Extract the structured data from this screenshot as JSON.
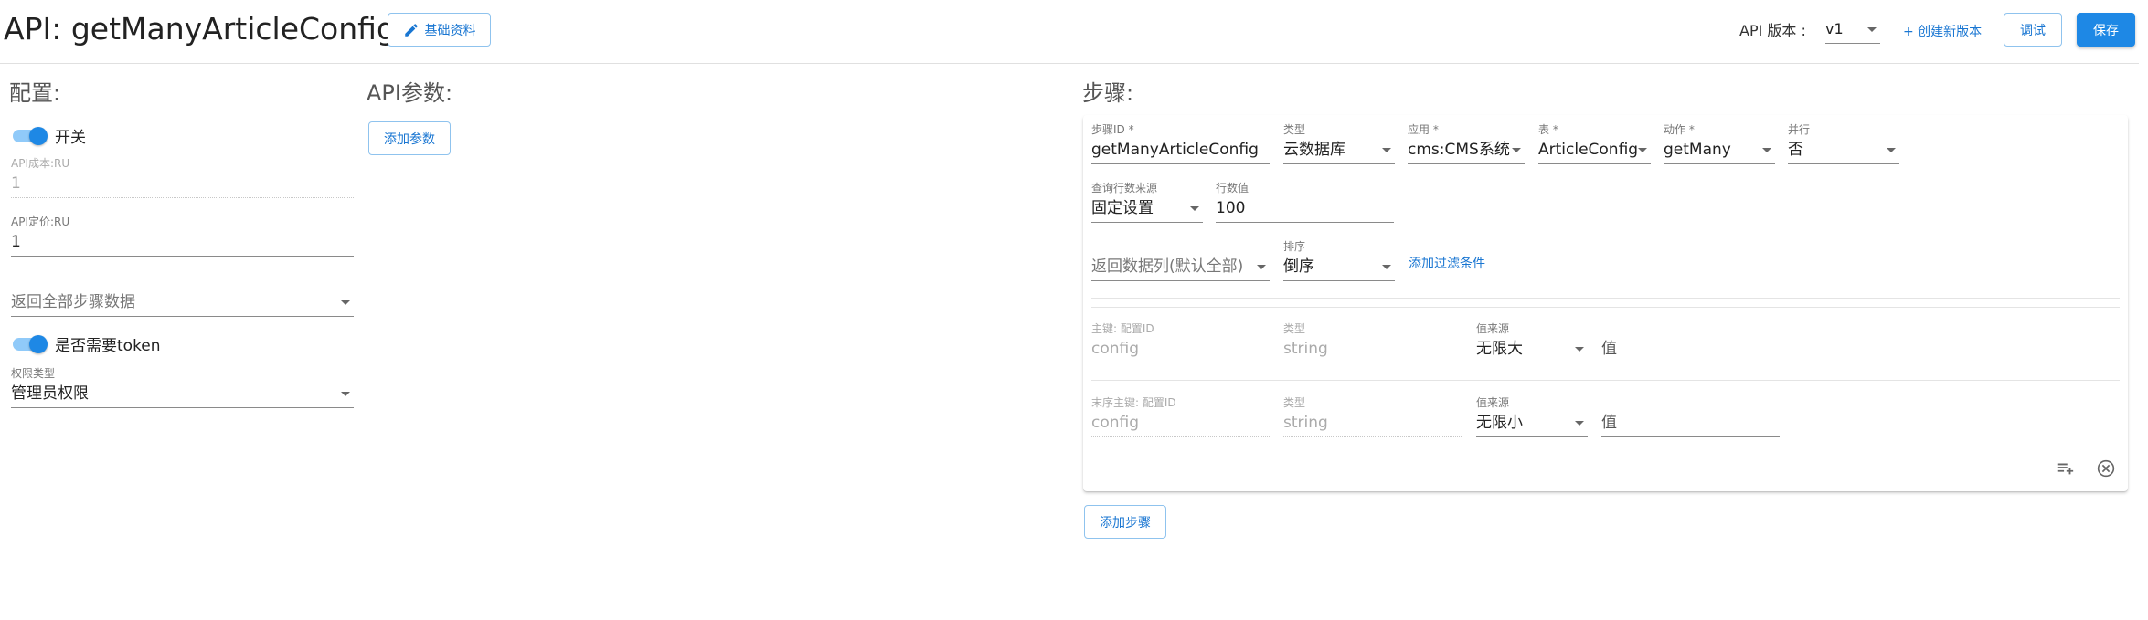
{
  "header": {
    "title": "API: getManyArticleConfig",
    "basic_info_label": "基础资料",
    "api_version_label": "API 版本 :",
    "api_version_value": "v1",
    "new_version_label": "+ 创建新版本",
    "debug_label": "调试",
    "save_label": "保存"
  },
  "config": {
    "title": "配置:",
    "switch_label": "开关",
    "cost_label": "API成本:RU",
    "cost_value": "1",
    "price_label": "API定价:RU",
    "price_value": "1",
    "return_all_placeholder": "返回全部步骤数据",
    "token_label": "是否需要token",
    "permission_label": "权限类型",
    "permission_value": "管理员权限"
  },
  "params": {
    "title": "API参数:",
    "add_label": "添加参数"
  },
  "steps": {
    "title": "步骤:",
    "add_step_label": "添加步骤",
    "step": {
      "step_id_label": "步骤ID *",
      "step_id_value": "getManyArticleConfig",
      "type_label": "类型",
      "type_value": "云数据库",
      "app_label": "应用 *",
      "app_value": "cms:CMS系统",
      "table_label": "表 *",
      "table_value": "ArticleConfig",
      "action_label": "动作 *",
      "action_value": "getMany",
      "parallel_label": "并行",
      "parallel_value": "否",
      "row_source_label": "查询行数来源",
      "row_source_value": "固定设置",
      "row_count_label": "行数值",
      "row_count_value": "100",
      "return_columns_placeholder": "返回数据列(默认全部)",
      "order_label": "排序",
      "order_value": "倒序",
      "add_filter_label": "添加过滤条件",
      "key_rows": [
        {
          "key_label": "主键: 配置ID",
          "key_value": "config",
          "type_label": "类型",
          "type_value": "string",
          "source_label": "值来源",
          "source_value": "无限大",
          "value_placeholder": "值"
        },
        {
          "key_label": "末序主键: 配置ID",
          "key_value": "config",
          "type_label": "类型",
          "type_value": "string",
          "source_label": "值来源",
          "source_value": "无限小",
          "value_placeholder": "值"
        }
      ]
    }
  },
  "icons": {
    "edit": "pencil-icon",
    "add_row": "playlist-add-icon",
    "remove": "close-circle-icon"
  },
  "colors": {
    "primary": "#1e88e5",
    "link": "#1976d2",
    "switch_track": "#90caf9"
  }
}
